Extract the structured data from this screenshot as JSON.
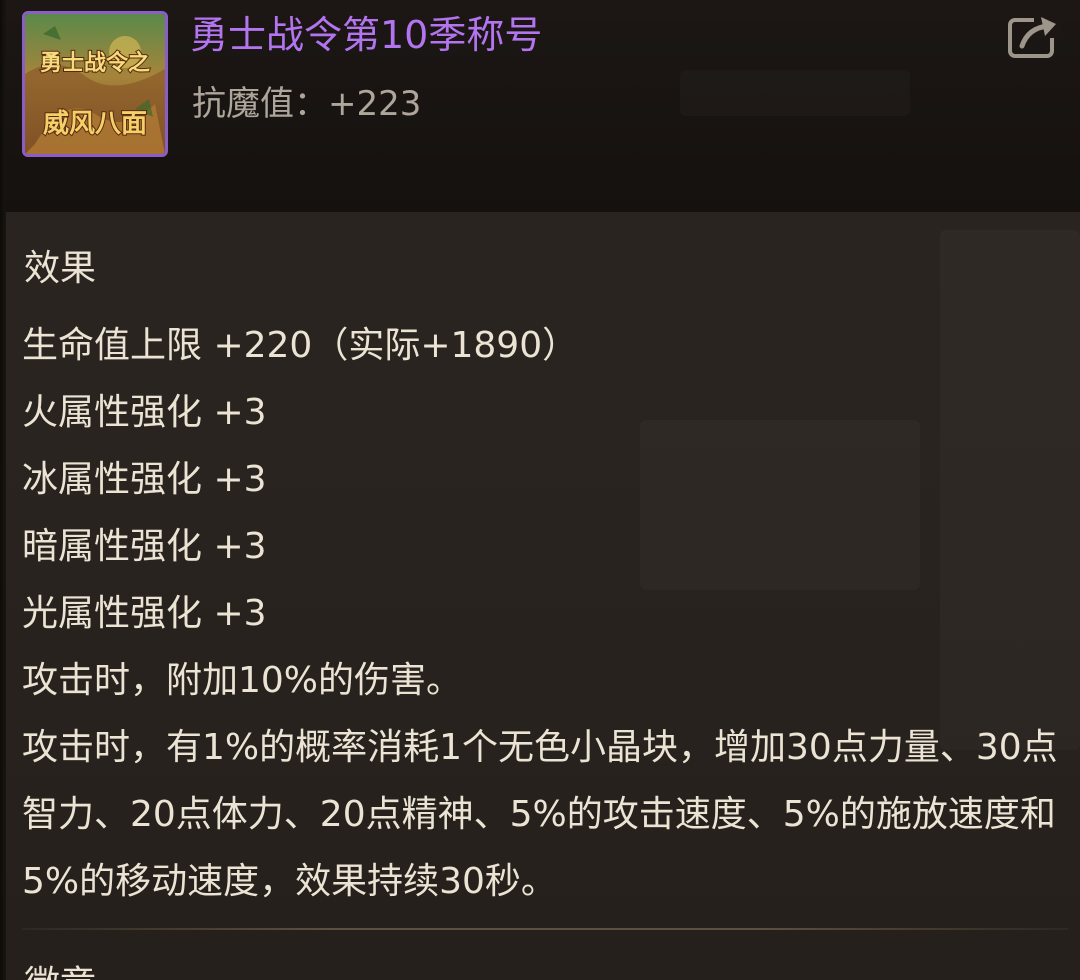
{
  "item": {
    "name": "勇士战令第10季称号",
    "icon": "title-badge-icon",
    "icon_text_line1": "勇士战令之",
    "icon_text_line2": "威风八面",
    "stat_label": "抗魔值：",
    "stat_value": "+223",
    "name_color": "#b374ef"
  },
  "share": {
    "icon": "share-icon"
  },
  "effects": {
    "title": "效果",
    "lines": [
      "生命值上限 +220（实际+1890）",
      "火属性强化 +3",
      "冰属性强化 +3",
      "暗属性强化 +3",
      "光属性强化 +3",
      "攻击时，附加10%的伤害。",
      "攻击时，有1%的概率消耗1个无色小晶块，增加30点力量、30点智力、20点体力、20点精神、5%的攻击速度、5%的施放速度和5%的移动速度，效果持续30秒。"
    ]
  },
  "next_section": {
    "title": "徽章"
  }
}
